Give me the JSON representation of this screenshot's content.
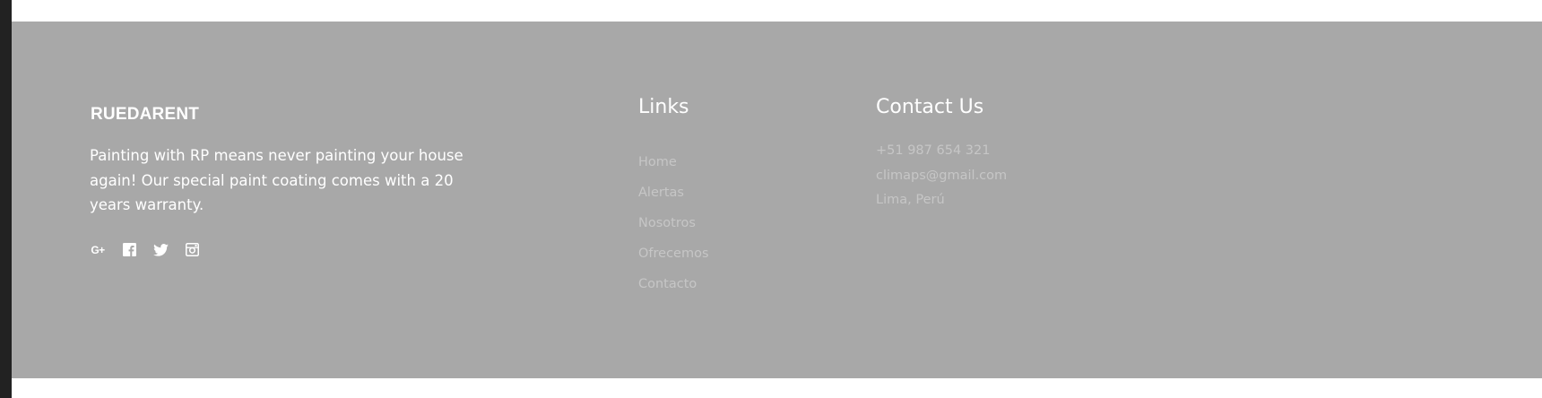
{
  "colors": {
    "footer_bg": "#a8a8a8",
    "text_primary": "#ffffff",
    "text_muted": "#c6c6c6",
    "left_strip": "#222222"
  },
  "brand": {
    "name": "RUEDARENT",
    "tagline": "Painting with RP means never painting your house again! Our special paint coating comes with a 20 years warranty."
  },
  "social": [
    {
      "icon": "google-plus-icon",
      "glyph": "G+"
    },
    {
      "icon": "facebook-icon"
    },
    {
      "icon": "twitter-icon"
    },
    {
      "icon": "instagram-icon"
    }
  ],
  "links": {
    "title": "Links",
    "items": [
      {
        "label": "Home"
      },
      {
        "label": "Alertas"
      },
      {
        "label": "Nosotros"
      },
      {
        "label": "Ofrecemos"
      },
      {
        "label": "Contacto"
      }
    ]
  },
  "contact": {
    "title": "Contact Us",
    "phone": "+51 987 654 321",
    "email": "climaps@gmail.com",
    "address": "Lima, Perú"
  }
}
